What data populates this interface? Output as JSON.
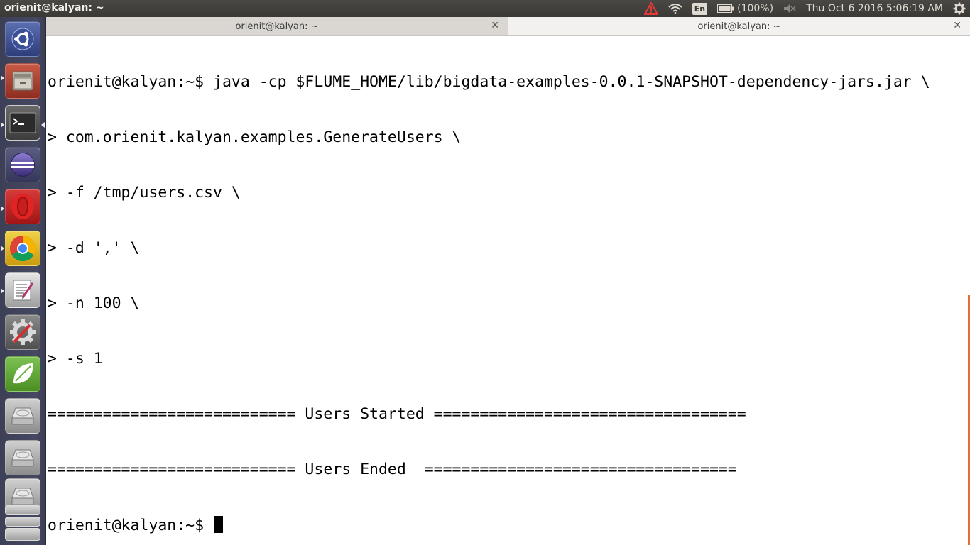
{
  "top_panel": {
    "window_title": "orienit@kalyan: ~",
    "keyboard_layout": "En",
    "battery_text": "(100%)",
    "clock": "Thu Oct  6 2016  5:06:19 AM"
  },
  "launcher": {
    "items": [
      {
        "name": "ubuntu-dash-icon"
      },
      {
        "name": "files-icon"
      },
      {
        "name": "terminal-icon"
      },
      {
        "name": "eclipse-icon"
      },
      {
        "name": "opera-icon"
      },
      {
        "name": "chrome-icon"
      },
      {
        "name": "text-editor-icon"
      },
      {
        "name": "system-settings-icon"
      },
      {
        "name": "spring-tool-suite-icon"
      },
      {
        "name": "disk-drive-icon"
      },
      {
        "name": "disk-drive-icon"
      },
      {
        "name": "disk-drive-icon"
      }
    ]
  },
  "tabs": [
    {
      "label": "orienit@kalyan: ~",
      "active": false
    },
    {
      "label": "orienit@kalyan: ~",
      "active": true
    }
  ],
  "terminal": {
    "lines": [
      "orienit@kalyan:~$ java -cp $FLUME_HOME/lib/bigdata-examples-0.0.1-SNAPSHOT-dependency-jars.jar \\",
      "> com.orienit.kalyan.examples.GenerateUsers \\",
      "> -f /tmp/users.csv \\",
      "> -d ',' \\",
      "> -n 100 \\",
      "> -s 1",
      "=========================== Users Started ==================================",
      "=========================== Users Ended  =================================="
    ],
    "prompt": "orienit@kalyan:~$ "
  }
}
